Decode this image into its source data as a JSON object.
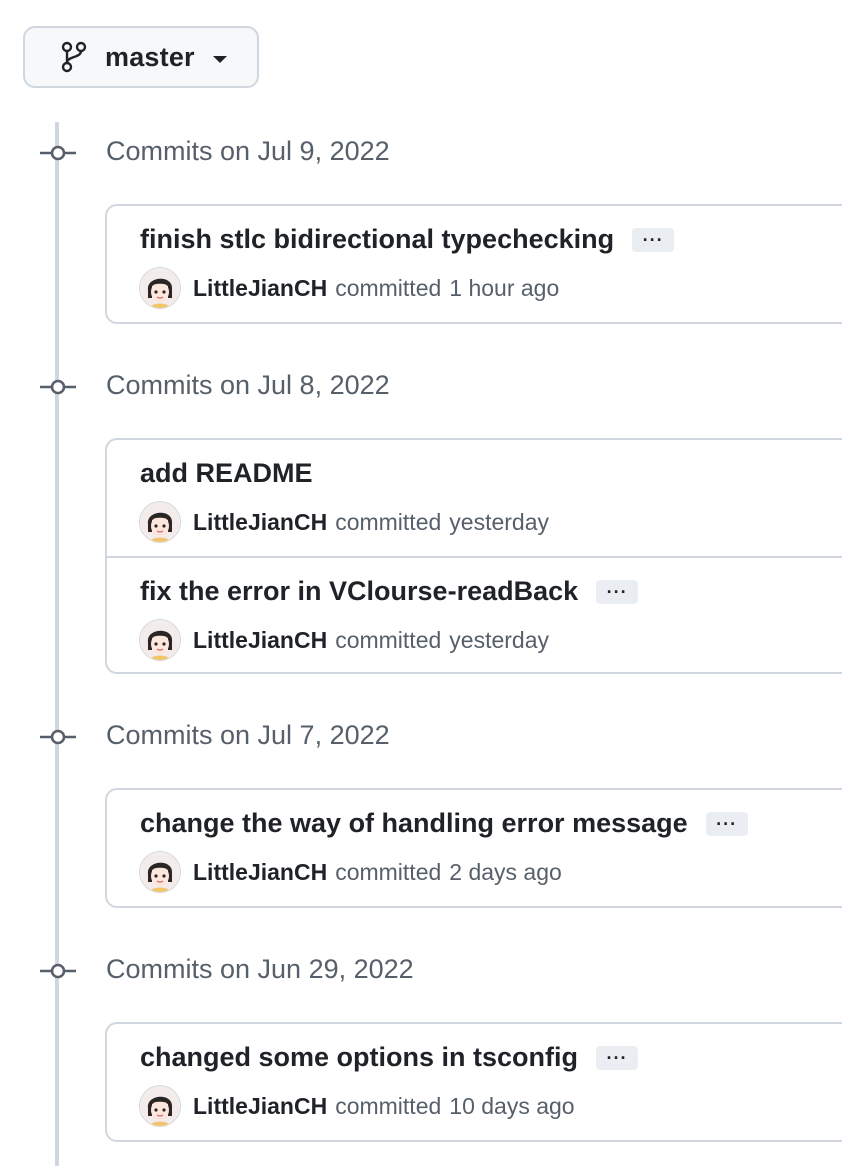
{
  "branch": {
    "label": "master"
  },
  "groups": [
    {
      "title": "Commits on Jul 9, 2022",
      "commits": [
        {
          "title": "finish stlc bidirectional typechecking",
          "has_ellipsis": true,
          "ellipsis": "···",
          "author": "LittleJianCH",
          "verb": "committed",
          "time": "1 hour ago"
        }
      ]
    },
    {
      "title": "Commits on Jul 8, 2022",
      "commits": [
        {
          "title": "add README",
          "has_ellipsis": false,
          "ellipsis": "",
          "author": "LittleJianCH",
          "verb": "committed",
          "time": "yesterday"
        },
        {
          "title": "fix the error in VClourse-readBack",
          "has_ellipsis": true,
          "ellipsis": "···",
          "author": "LittleJianCH",
          "verb": "committed",
          "time": "yesterday"
        }
      ]
    },
    {
      "title": "Commits on Jul 7, 2022",
      "commits": [
        {
          "title": "change the way of handling error message",
          "has_ellipsis": true,
          "ellipsis": "···",
          "author": "LittleJianCH",
          "verb": "committed",
          "time": "2 days ago"
        }
      ]
    },
    {
      "title": "Commits on Jun 29, 2022",
      "commits": [
        {
          "title": "changed some options in tsconfig",
          "has_ellipsis": true,
          "ellipsis": "···",
          "author": "LittleJianCH",
          "verb": "committed",
          "time": "10 days ago"
        }
      ]
    }
  ],
  "colors": {
    "border": "#d0d7de",
    "muted_text": "#57606a",
    "text": "#1f2328",
    "button_bg": "#f6f8fa"
  }
}
